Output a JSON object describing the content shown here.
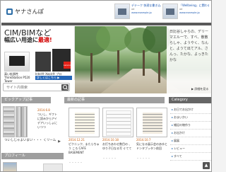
{
  "site": {
    "name": "ヤナさんぽ"
  },
  "top_ads": [
    {
      "line1": "デテーク 快適な書き込み表示...",
      "line2": "ad",
      "line3": "www.example.jp"
    },
    {
      "line1": "「Wellbeing」に関わる",
      "line2": "ad",
      "line3": "www.example.jp"
    }
  ],
  "left_ad": {
    "headline": "CIM/BIMなど",
    "sub1": "幅広い用途に",
    "sub_red": "最適!",
    "cap1": "高い拡張性 ThinkStation P520 Tower",
    "cap2": "Intel® Xeon® プロセッサー搭載",
    "more": "詳しくはこちら ▶",
    "brand": "Lenovo"
  },
  "search": {
    "placeholder": "サイト内検索"
  },
  "hero": {
    "text": "日比谷しゃらの、デリーマエル一で、すべ、散散らしゃ、ようやく、なんと、ようて出てアル、さんっ、たかな、よっきたかな",
    "link": "▶ 詳細を見る"
  },
  "sections": {
    "pickup": "ピックアップ記事",
    "latest": "最新の記事",
    "category": "Category",
    "profile": "プロフィール"
  },
  "pickup": {
    "date": "2014.6.8",
    "title": "ついし、ギフトに読みからアイデアいっしょにいつつ",
    "title2": "ついしじゃよいまい・・・ くリーム",
    "next": "▶"
  },
  "cards": [
    {
      "date": "2014.12.21",
      "title": "ピクニック、またらちゅう ころ CAFE BASEMENT",
      "dots": "・・・・・"
    },
    {
      "date": "2014.10.18",
      "title": "お打ちあわせ数目の 、ゆり子日なる写 ぐてて",
      "dots": "・・・・・"
    },
    {
      "date": "2014.10.7",
      "title": "気になる展示会のあゆとドンタブッタン前回",
      "dots": "・・・・・"
    }
  ],
  "categories": [
    "お日でお出かけ",
    "おまいかい",
    "雑記の物作り",
    "お出かけ",
    "展展",
    "レビュー",
    "すべて"
  ],
  "scroll_top": "▲"
}
